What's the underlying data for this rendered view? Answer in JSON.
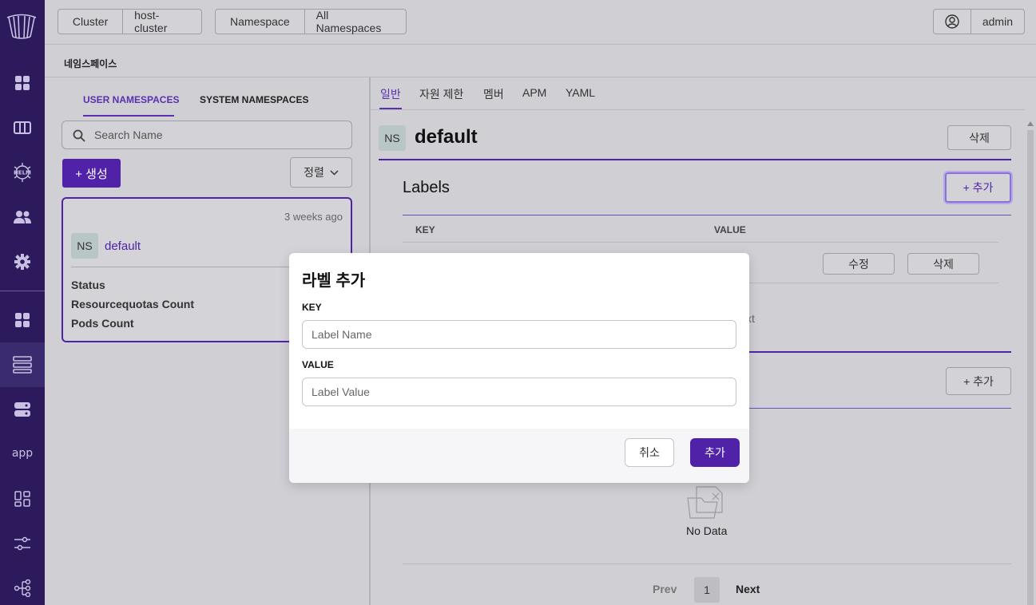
{
  "sidebar": {
    "logo": "harbor-logo",
    "items": [
      {
        "name": "dashboard-icon"
      },
      {
        "name": "columns-icon"
      },
      {
        "name": "helm-icon",
        "label": "HELM"
      },
      {
        "name": "users-icon"
      },
      {
        "name": "settings-icon"
      },
      {
        "name": "apps-grid-icon"
      },
      {
        "name": "namespace-icon",
        "active": true
      },
      {
        "name": "server-icon"
      },
      {
        "name": "app-text",
        "label": "app"
      },
      {
        "name": "widgets-icon"
      },
      {
        "name": "sliders-icon"
      },
      {
        "name": "network-tree-icon"
      }
    ]
  },
  "topbar": {
    "cluster_label": "Cluster",
    "cluster_value": "host-cluster",
    "namespace_label": "Namespace",
    "namespace_value": "All Namespaces",
    "user_name": "admin"
  },
  "page": {
    "title": "네임스페이스"
  },
  "left": {
    "tabs": [
      "USER NAMESPACES",
      "SYSTEM NAMESPACES"
    ],
    "search_placeholder": "Search Name",
    "create_label": "+ 생성",
    "sort_label": "정렬",
    "card": {
      "time": "3 weeks ago",
      "badge": "NS",
      "name": "default",
      "fields": [
        "Status",
        "Resourcequotas Count",
        "Pods Count"
      ]
    }
  },
  "right": {
    "tabs": [
      "일반",
      "자원 제한",
      "멤버",
      "APM",
      "YAML"
    ],
    "badge": "NS",
    "name": "default",
    "delete_label": "삭제",
    "labels_title": "Labels",
    "add_label": "+ 추가",
    "col_key": "KEY",
    "col_value": "VALUE",
    "row_value_partial": "t",
    "edit_label": "수정",
    "row_delete_label": "삭제",
    "next_partial": "xt",
    "add2_label": "+ 추가",
    "no_data": "No Data",
    "pager": {
      "prev": "Prev",
      "page": "1",
      "next": "Next"
    }
  },
  "modal": {
    "title": "라벨 추가",
    "key_label": "KEY",
    "key_placeholder": "Label Name",
    "value_label": "VALUE",
    "value_placeholder": "Label Value",
    "cancel_label": "취소",
    "confirm_label": "추가"
  },
  "colors": {
    "accent": "#4f22a8",
    "sidebar": "#2c1a5c"
  }
}
